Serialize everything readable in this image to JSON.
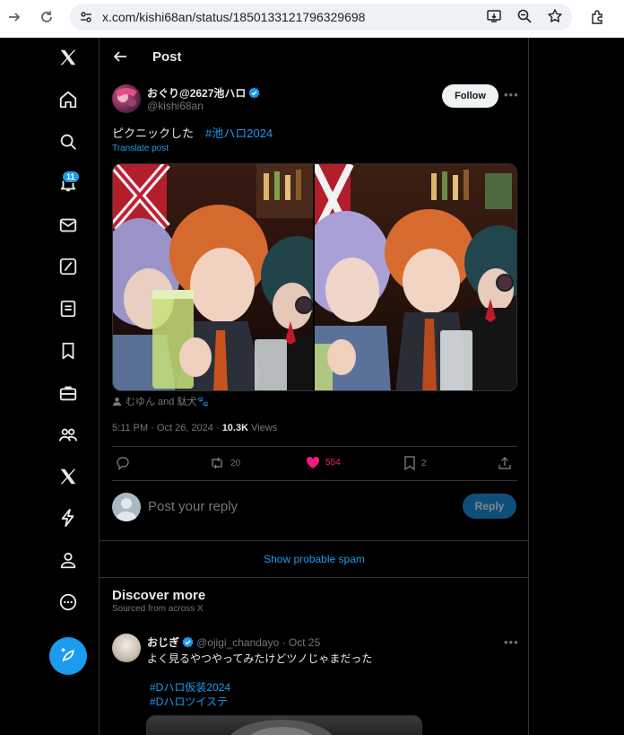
{
  "browser": {
    "url": "x.com/kishi68an/status/1850133121796329698",
    "icons": [
      "forward-icon",
      "reload-icon",
      "site-settings-icon",
      "install-app-icon",
      "zoom-icon",
      "bookmark-star-icon",
      "extensions-icon"
    ]
  },
  "sidebar": {
    "icons": [
      "x-logo-icon",
      "home-icon",
      "explore-icon",
      "notifications-icon",
      "messages-icon",
      "grok-icon",
      "lists-icon",
      "bookmarks-icon",
      "jobs-icon",
      "communities-icon",
      "premium-icon",
      "verified-orgs-icon",
      "profile-icon",
      "more-icon",
      "compose-icon"
    ],
    "notification_count": "11"
  },
  "header": {
    "title": "Post"
  },
  "post": {
    "author_name": "おぐり@2627池ハロ",
    "author_handle": "@kishi68an",
    "follow_label": "Follow",
    "text": "ピクニックした　",
    "hashtag": "#池ハロ2024",
    "translate_label": "Translate post",
    "tagged_users": "むゆん and 駄犬🐾",
    "time": "5:11 PM · Oct 26, 2024 · ",
    "views_count": "10.3K",
    "views_label": " Views",
    "stats": {
      "reposts": "20",
      "likes": "554",
      "bookmarks": "2"
    }
  },
  "reply": {
    "placeholder": "Post your reply",
    "button_label": "Reply"
  },
  "spam_label": "Show probable spam",
  "discover": {
    "title": "Discover more",
    "subtitle": "Sourced from across X",
    "post": {
      "author_name": "おじぎ",
      "meta": "@ojigi_chandayo · Oct 25",
      "text": "よく見るやつやってみたけどツノじゃまだった",
      "hashtags": [
        "#Dハロ仮装2024",
        "#Dハロツイステ"
      ]
    }
  },
  "colors": {
    "accent": "#1d9bf0",
    "like": "#f91880",
    "background": "#000000",
    "border": "#2f3336",
    "muted": "#71767b"
  }
}
